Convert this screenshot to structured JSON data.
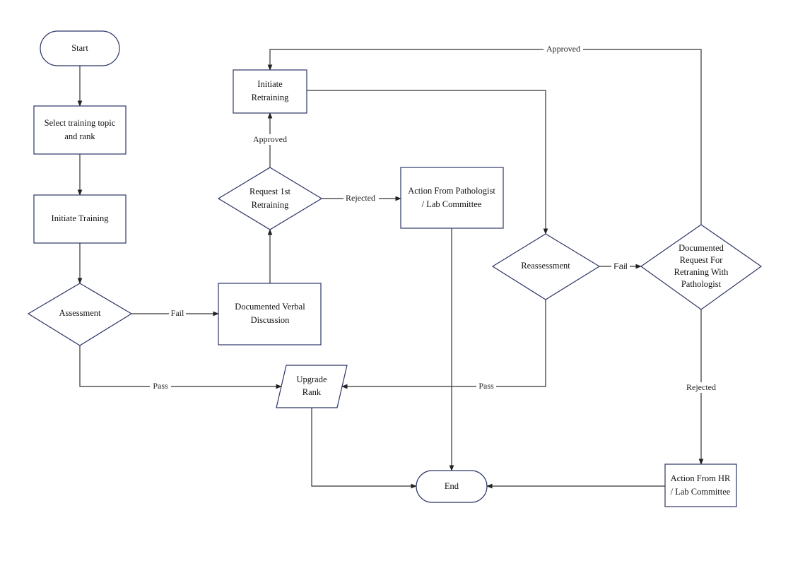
{
  "colors": {
    "shape_stroke": "#2c3566",
    "connector": "#333333",
    "background": "#ffffff"
  },
  "nodes": {
    "start": {
      "lines": [
        "Start"
      ]
    },
    "select_topic": {
      "lines": [
        "Select training topic",
        "and rank"
      ]
    },
    "initiate_training": {
      "lines": [
        "Initiate Training"
      ]
    },
    "assessment": {
      "lines": [
        "Assessment"
      ]
    },
    "verbal_discussion": {
      "lines": [
        "Documented Verbal",
        "Discussion"
      ]
    },
    "request_retraining": {
      "lines": [
        "Request 1st",
        "Retraining"
      ]
    },
    "initiate_retraining": {
      "lines": [
        "Initiate",
        "Retraining"
      ]
    },
    "action_pathologist": {
      "lines": [
        "Action From Pathologist",
        "/ Lab Committee"
      ]
    },
    "reassessment": {
      "lines": [
        "Reassessment"
      ]
    },
    "documented_request": {
      "lines": [
        "Documented",
        "Request For",
        "Retraning With",
        "Pathologist"
      ]
    },
    "upgrade_rank": {
      "lines": [
        "Upgrade",
        "Rank"
      ]
    },
    "end": {
      "lines": [
        "End"
      ]
    },
    "action_hr": {
      "lines": [
        "Action From HR",
        "/ Lab Committee"
      ]
    }
  },
  "edges": {
    "assessment_fail": "Fail",
    "assessment_pass": "Pass",
    "request_approved": "Approved",
    "request_rejected": "Rejected",
    "reassessment_fail": "Fail",
    "reassessment_pass": "Pass",
    "documented_approved": "Approved",
    "documented_rejected": "Rejected"
  }
}
